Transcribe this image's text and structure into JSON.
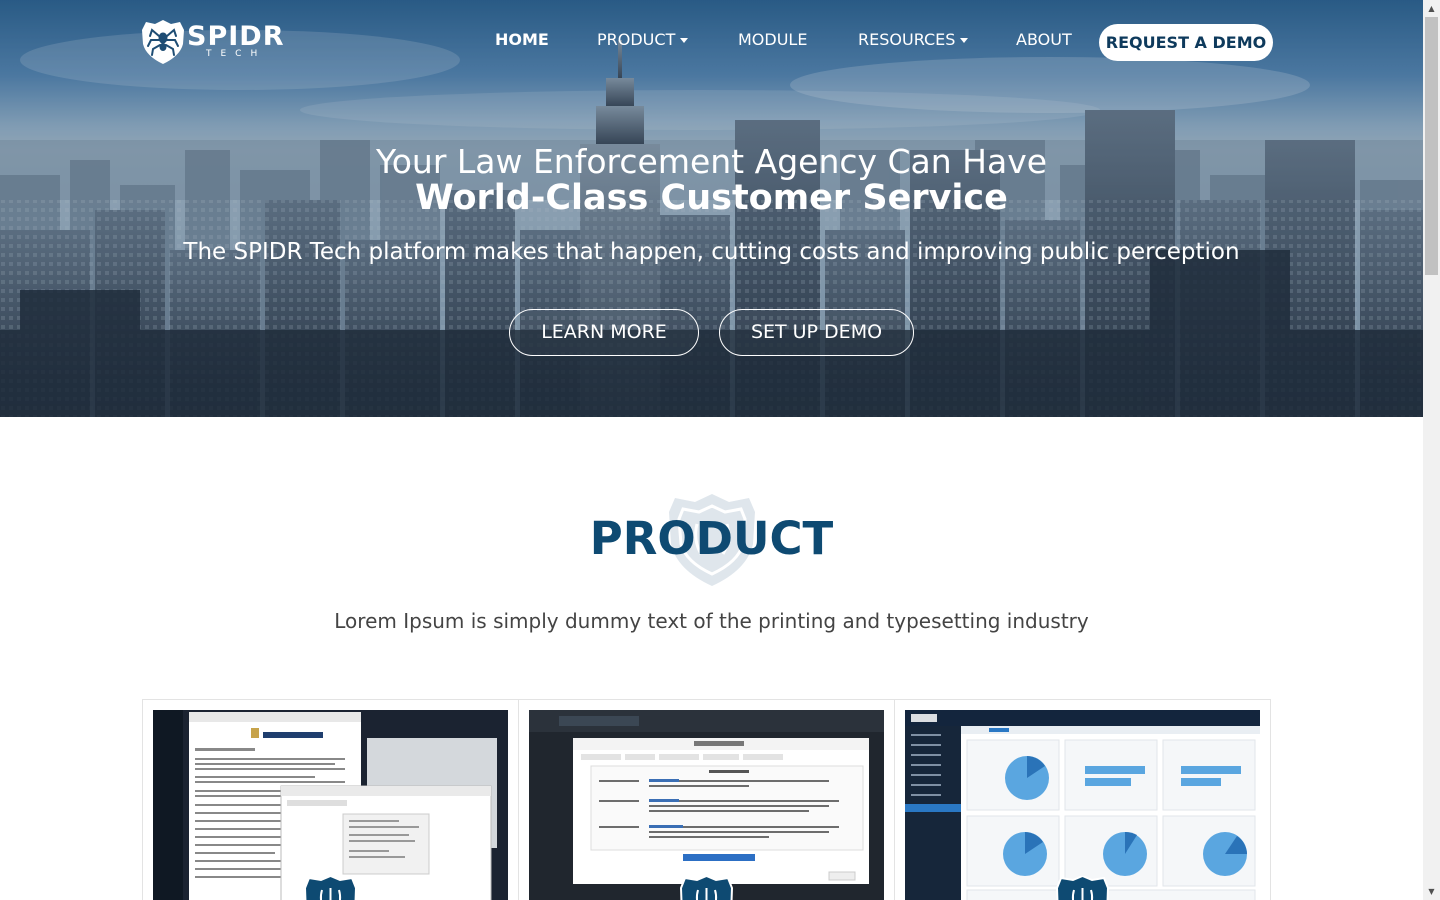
{
  "brand": {
    "name": "SPIDR",
    "sub": "TECH"
  },
  "nav": {
    "items": [
      {
        "label": "HOME",
        "dropdown": false
      },
      {
        "label": "PRODUCT",
        "dropdown": true
      },
      {
        "label": "MODULE",
        "dropdown": false
      },
      {
        "label": "RESOURCES",
        "dropdown": true
      },
      {
        "label": "ABOUT",
        "dropdown": false
      }
    ],
    "cta": "REQUEST A DEMO"
  },
  "hero": {
    "title_line1": "Your Law Enforcement Agency Can Have",
    "title_line2": "World-Class Customer Service",
    "subtitle": "The SPIDR Tech platform makes that happen, cutting costs and improving public perception",
    "buttons": [
      "LEARN MORE",
      "SET UP DEMO"
    ]
  },
  "product": {
    "title": "PRODUCT",
    "subtitle": "Lorem Ipsum is simply dummy text of the printing and typesetting industry"
  },
  "colors": {
    "primary": "#0e4a72",
    "cta_text": "#0e3a5c",
    "hero_overlay": "#1f4a72",
    "card_dark": "#16263a"
  }
}
